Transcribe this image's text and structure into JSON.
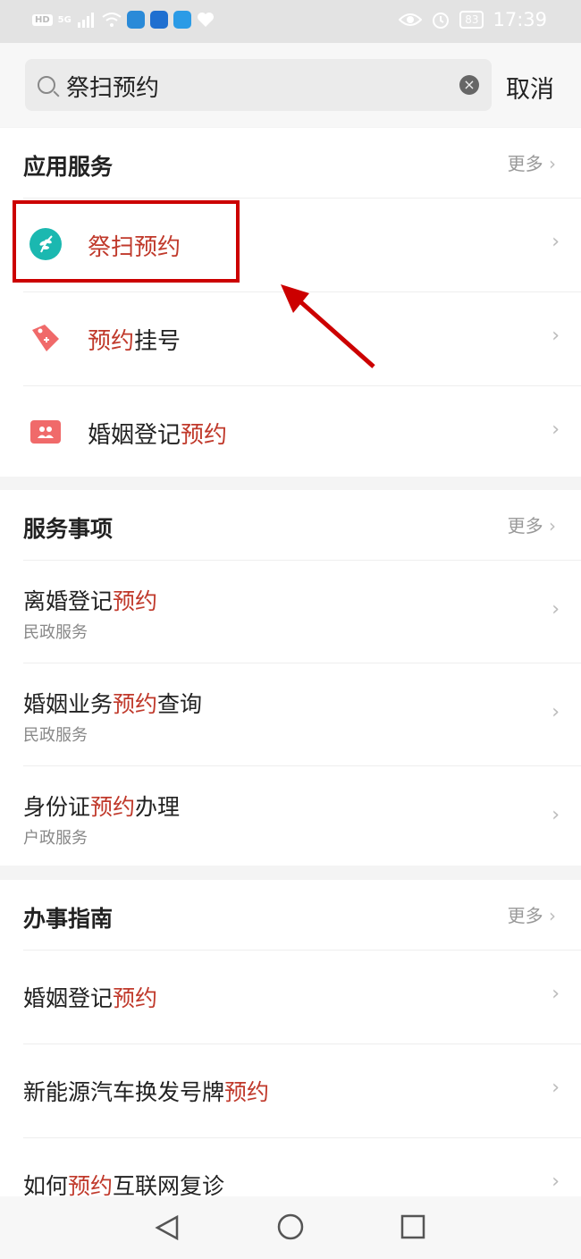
{
  "status": {
    "hd": "HD",
    "signal": "5G",
    "battery": "83",
    "time": "17:39"
  },
  "search": {
    "query": "祭扫预约",
    "cancel": "取消"
  },
  "apps": {
    "title": "应用服务",
    "more": "更多",
    "items": [
      {
        "pre": "",
        "hl": "祭扫预约",
        "post": ""
      },
      {
        "pre": "",
        "hl": "预约",
        "post": "挂号"
      },
      {
        "pre": "婚姻登记",
        "hl": "预约",
        "post": ""
      }
    ]
  },
  "services": {
    "title": "服务事项",
    "more": "更多",
    "items": [
      {
        "pre": "离婚登记",
        "hl": "预约",
        "post": "",
        "sub": "民政服务"
      },
      {
        "pre": "婚姻业务",
        "hl": "预约",
        "post": "查询",
        "sub": "民政服务"
      },
      {
        "pre": "身份证",
        "hl": "预约",
        "post": "办理",
        "sub": "户政服务"
      }
    ]
  },
  "guides": {
    "title": "办事指南",
    "more": "更多",
    "items": [
      {
        "pre": "婚姻登记",
        "hl": "预约",
        "post": ""
      },
      {
        "pre": "新能源汽车换发号牌",
        "hl": "预约",
        "post": ""
      },
      {
        "pre": "如何",
        "hl": "预约",
        "post": "互联网复诊"
      }
    ]
  },
  "colors": {
    "accent": "#c0392b",
    "annotation": "#cc0000",
    "teal": "#1bb8b0",
    "pink": "#f06a6a"
  }
}
